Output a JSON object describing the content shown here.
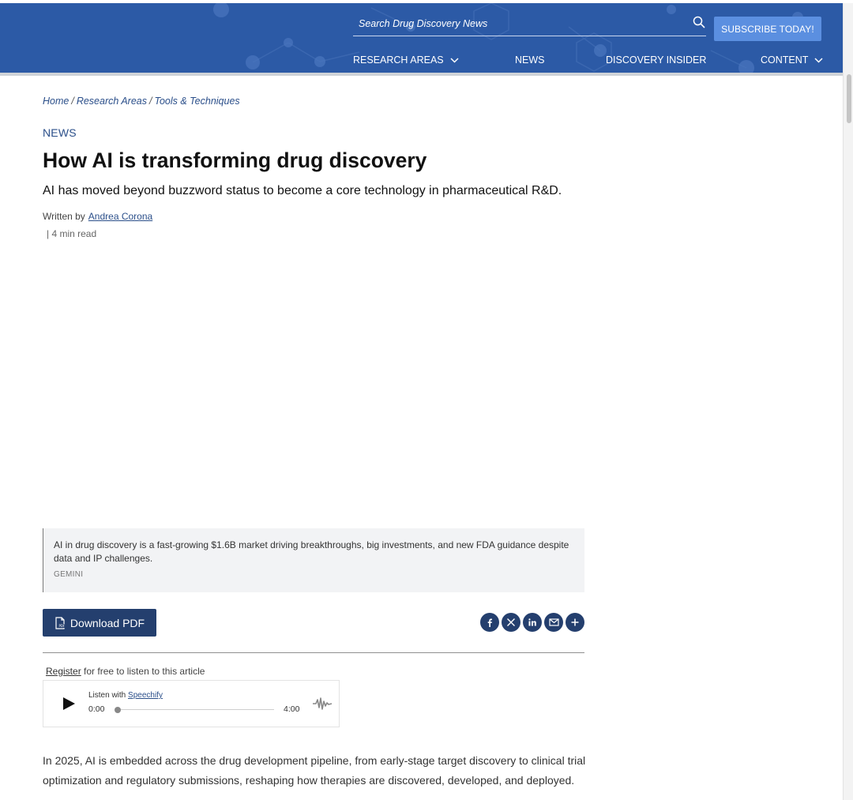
{
  "header": {
    "search_placeholder": "Search Drug Discovery News",
    "subscribe_label": "SUBSCRIBE TODAY!",
    "nav": [
      {
        "label": "RESEARCH AREAS"
      },
      {
        "label": "NEWS"
      },
      {
        "label": "DISCOVERY INSIDER"
      },
      {
        "label": "CONTENT"
      }
    ],
    "colors": {
      "header_bg": "#2c5aa6",
      "subscribe_bg": "#5b8fe0"
    }
  },
  "breadcrumb": [
    "Home",
    "Research Areas",
    "Tools & Techniques"
  ],
  "article": {
    "kicker": "NEWS",
    "title": "How AI is transforming drug discovery",
    "subtitle": "AI has moved beyond buzzword status to become a core technology in pharmaceutical R&D.",
    "byline_prefix": "Written by",
    "author": "Andrea Corona",
    "read_time": "| 4 min read",
    "caption": "AI in drug discovery is a fast-growing $1.6B market driving breakthroughs, big investments, and new FDA guidance despite data and IP challenges.",
    "caption_credit": "GEMINI",
    "download_pdf_label": "Download PDF",
    "share_icons": [
      "facebook-icon",
      "x-icon",
      "linkedin-icon",
      "email-icon",
      "plus-icon"
    ],
    "register_link": "Register",
    "register_suffix": "for free to listen to this article",
    "player": {
      "listen_prefix": "Listen with",
      "brand": "Speechify",
      "time_current": "0:00",
      "time_total": "4:00",
      "progress_fraction": 0.0
    },
    "body_paragraph": "In 2025, AI is embedded across the drug development pipeline, from early-stage target discovery to clinical trial optimization and regulatory submissions, reshaping how therapies are discovered, developed, and deployed."
  },
  "colors": {
    "accent_dark": "#243f6e",
    "link": "#2b4f8a"
  }
}
